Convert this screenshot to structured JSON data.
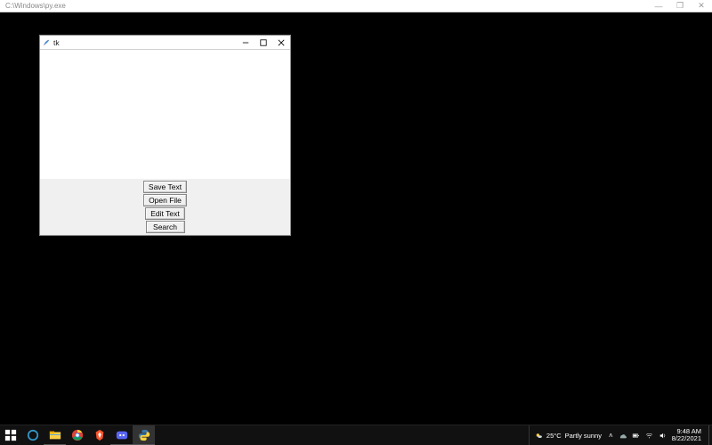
{
  "parent_window": {
    "title": "C:\\Windows\\py.exe",
    "controls": {
      "minimize": "—",
      "maximize": "❐",
      "close": "✕"
    }
  },
  "tk_window": {
    "title": "tk",
    "controls": {
      "minimize": "tk-min",
      "maximize": "tk-max",
      "close": "tk-close"
    },
    "text_content": "",
    "buttons": [
      {
        "id": "save-text",
        "label": "Save Text"
      },
      {
        "id": "open-file",
        "label": "Open File"
      },
      {
        "id": "edit-text",
        "label": "Edit Text"
      },
      {
        "id": "search",
        "label": "Search"
      }
    ]
  },
  "taskbar": {
    "apps": [
      {
        "id": "cortana",
        "label": "Cortana",
        "running": false
      },
      {
        "id": "fileexplorer",
        "label": "File Explorer",
        "running": true
      },
      {
        "id": "chrome",
        "label": "Google Chrome",
        "running": false
      },
      {
        "id": "brave",
        "label": "Brave",
        "running": false
      },
      {
        "id": "discord",
        "label": "Discord",
        "running": true
      },
      {
        "id": "python",
        "label": "Python",
        "running": true,
        "active": true
      }
    ],
    "weather": {
      "temp": "25°C",
      "condition": "Partly sunny"
    },
    "tray_icons": [
      "show-hidden",
      "onedrive",
      "power",
      "wifi",
      "volume"
    ],
    "clock": {
      "time": "9:48 AM",
      "date": "8/22/2021"
    }
  }
}
